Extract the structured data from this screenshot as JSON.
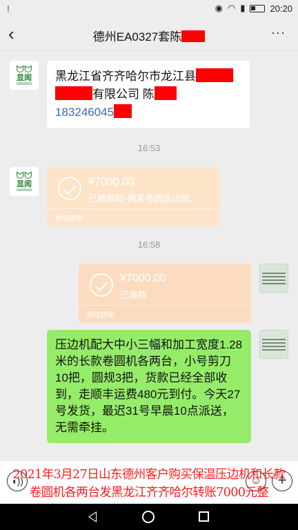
{
  "status_bar": {
    "notification": "!",
    "time": "20:20"
  },
  "header": {
    "title": "德州EA0327套陈",
    "back_icon": "chevron-left-icon",
    "more_label": "···"
  },
  "messages": {
    "contact_card": {
      "line1": "黑龙江省齐齐哈尔市龙江县",
      "line2_suffix": "有限公司  陈",
      "phone": "183246045"
    },
    "time1": "16:53",
    "transfer1": {
      "amount": "¥7000.00",
      "desc": "已被领取-两套卷圆压边机...",
      "foot": "微信转账"
    },
    "time2": "16:58",
    "transfer2": {
      "amount": "¥7000.00",
      "desc": "已收款",
      "foot": "微信转账"
    },
    "reply": "压边机配大中小三幅和加工宽度1.28米的长款卷圆机各两台，小号剪刀10把，圆规3把，货款已经全部收到，走顺丰运费480元到付。今天27号发货，最迟31号早晨10点派送，无需牵挂。"
  },
  "avatar": {
    "logo_cn": "显闻",
    "logo_en": "XIANWEN"
  },
  "caption": {
    "line1": "2021年3月27日山东德州客户购买保温压边机和长款",
    "line2": "卷圆机各两台发黑龙江齐齐哈尔转账7000元整"
  },
  "colors": {
    "bubble_green": "#95ec69",
    "transfer_orange": "#fbdcc0",
    "redaction": "#ff0000",
    "caption_red": "#ff1a1a"
  }
}
